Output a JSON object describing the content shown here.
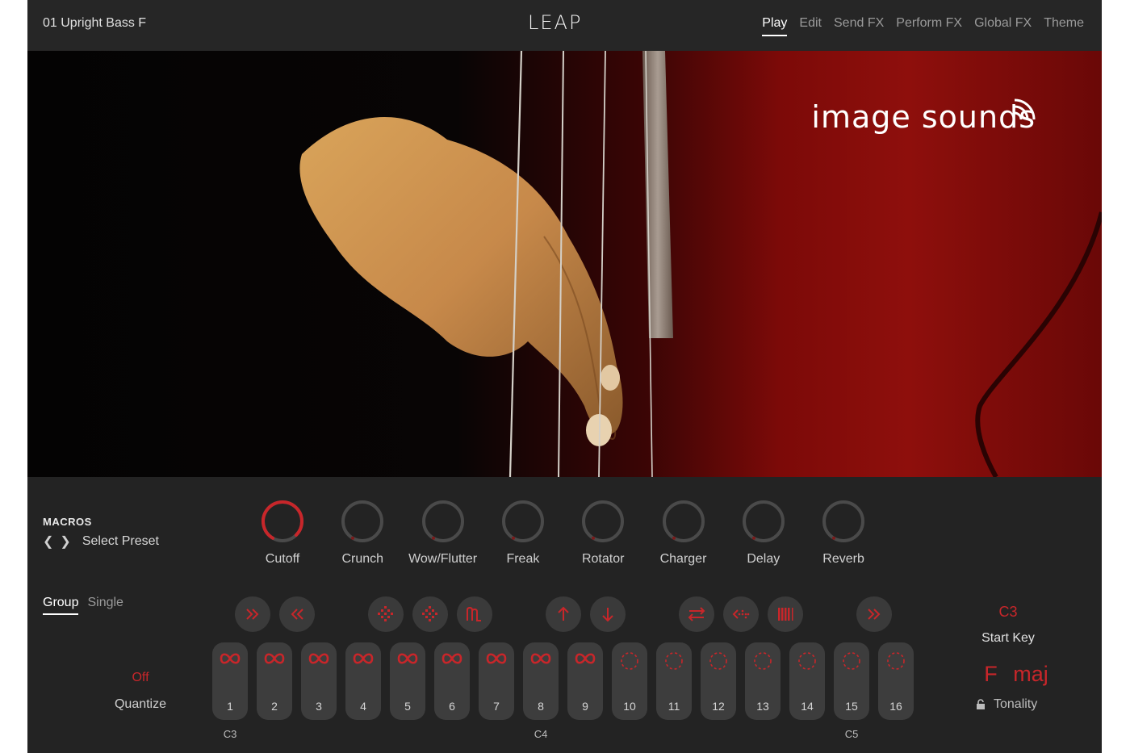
{
  "header": {
    "preset_name": "01 Upright Bass F",
    "logo": "LEAP",
    "tabs": [
      {
        "label": "Play",
        "active": true
      },
      {
        "label": "Edit",
        "active": false
      },
      {
        "label": "Send FX",
        "active": false
      },
      {
        "label": "Perform FX",
        "active": false
      },
      {
        "label": "Global FX",
        "active": false
      },
      {
        "label": "Theme",
        "active": false
      }
    ]
  },
  "hero": {
    "brand": "image sounds"
  },
  "macros": {
    "title": "MACROS",
    "select_preset": "Select Preset",
    "knobs": [
      {
        "label": "Cutoff",
        "value": 0.95
      },
      {
        "label": "Crunch",
        "value": 0.0
      },
      {
        "label": "Wow/Flutter",
        "value": 0.0
      },
      {
        "label": "Freak",
        "value": 0.0
      },
      {
        "label": "Rotator",
        "value": 0.0
      },
      {
        "label": "Charger",
        "value": 0.0
      },
      {
        "label": "Delay",
        "value": 0.0
      },
      {
        "label": "Reverb",
        "value": 0.0
      }
    ]
  },
  "mode": {
    "group": "Group",
    "single": "Single",
    "active": "group"
  },
  "quantize": {
    "value": "Off",
    "label": "Quantize"
  },
  "actions": [
    {
      "icon": "fast-forward-icon"
    },
    {
      "icon": "rewind-icon"
    },
    {
      "icon": "scatter-diagonal-icon"
    },
    {
      "icon": "scatter-reverse-icon"
    },
    {
      "icon": "shape-wave-icon"
    },
    {
      "icon": "arrow-up-icon"
    },
    {
      "icon": "arrow-down-icon"
    },
    {
      "icon": "swap-icon"
    },
    {
      "icon": "dotted-arrow-icon"
    },
    {
      "icon": "bars-icon"
    },
    {
      "icon": "fast-forward-icon"
    }
  ],
  "pads": [
    {
      "num": "1",
      "loaded": true
    },
    {
      "num": "2",
      "loaded": true
    },
    {
      "num": "3",
      "loaded": true
    },
    {
      "num": "4",
      "loaded": true
    },
    {
      "num": "5",
      "loaded": true
    },
    {
      "num": "6",
      "loaded": true
    },
    {
      "num": "7",
      "loaded": true
    },
    {
      "num": "8",
      "loaded": true
    },
    {
      "num": "9",
      "loaded": true
    },
    {
      "num": "10",
      "loaded": false
    },
    {
      "num": "11",
      "loaded": false
    },
    {
      "num": "12",
      "loaded": false
    },
    {
      "num": "13",
      "loaded": false
    },
    {
      "num": "14",
      "loaded": false
    },
    {
      "num": "15",
      "loaded": false
    },
    {
      "num": "16",
      "loaded": false
    }
  ],
  "note_labels": {
    "c3": "C3",
    "c4": "C4",
    "c5": "C5"
  },
  "start_key": {
    "value": "C3",
    "label": "Start Key"
  },
  "tonality": {
    "key": "F",
    "scale": "maj",
    "label": "Tonality"
  },
  "colors": {
    "accent": "#c8262a",
    "background": "#232323",
    "pad": "#3d3d3d"
  }
}
